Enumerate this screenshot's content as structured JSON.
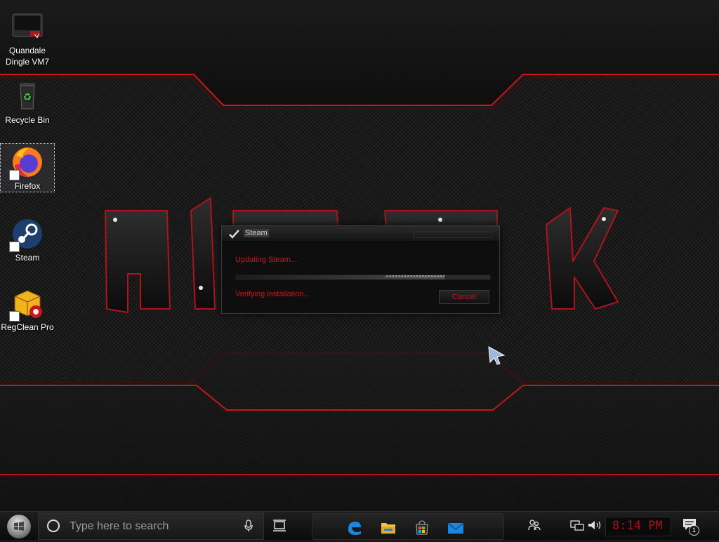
{
  "desktop": {
    "icons": [
      {
        "label": "Quandale Dingle VM7",
        "icon": "computer-icon",
        "shortcut": false,
        "selected": false
      },
      {
        "label": "Recycle Bin",
        "icon": "recycle-bin-icon",
        "shortcut": false,
        "selected": false
      },
      {
        "label": "Firefox",
        "icon": "firefox-icon",
        "shortcut": true,
        "selected": true
      },
      {
        "label": "Steam",
        "icon": "steam-icon",
        "shortcut": true,
        "selected": false
      },
      {
        "label": "RegClean Pro",
        "icon": "regclean-icon",
        "shortcut": true,
        "selected": false
      }
    ]
  },
  "dialog": {
    "title": "Steam",
    "status_line": "Updating Steam...",
    "detail_line": "Verifying installation...",
    "cancel_label": "Cancel",
    "progress": 0.82
  },
  "taskbar": {
    "search_placeholder": "Type here to search",
    "pinned": [
      "edge-icon",
      "file-explorer-icon",
      "store-icon",
      "mail-icon"
    ],
    "clock": "8:14 PM",
    "notification_count": "1"
  },
  "colors": {
    "accent_red": "#c8141b",
    "clock_red": "#a5121a"
  }
}
